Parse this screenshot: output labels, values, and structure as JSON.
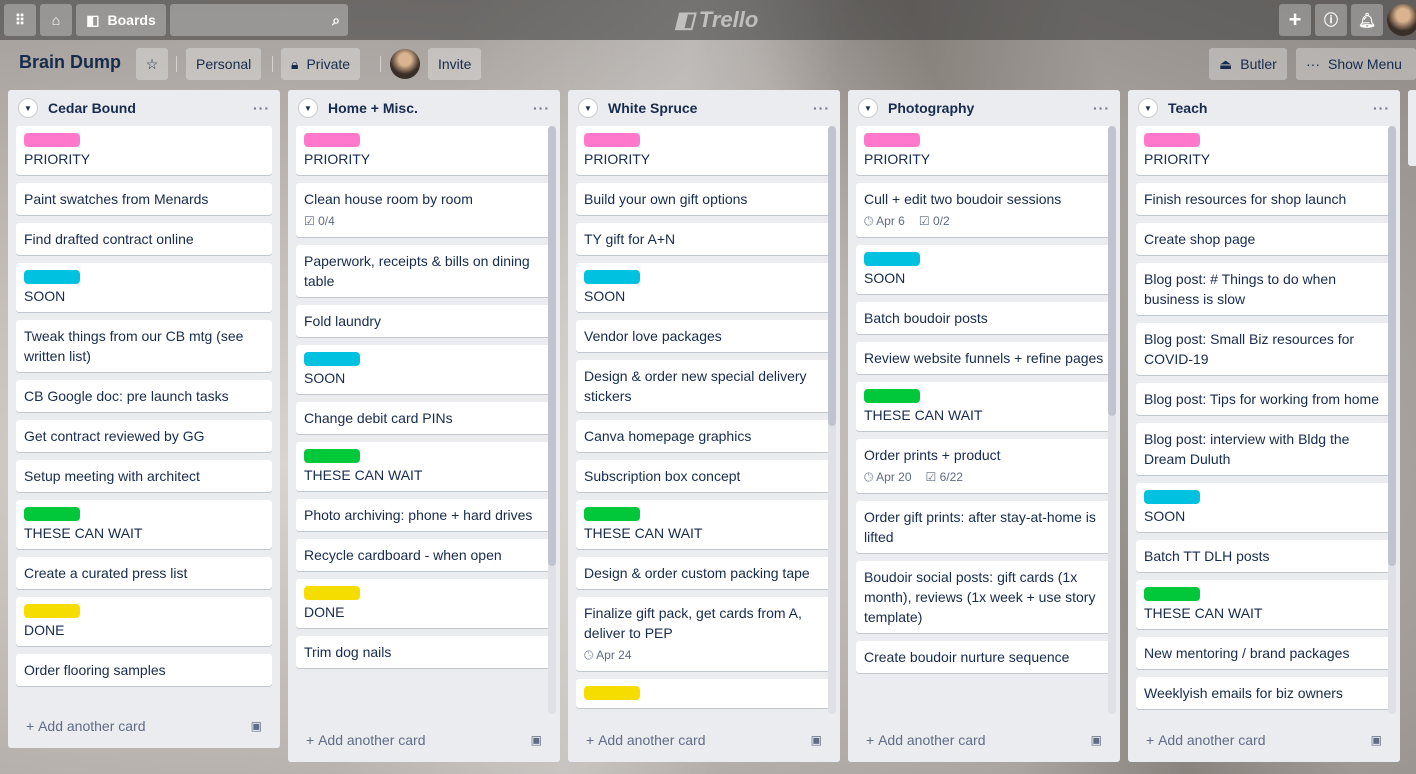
{
  "header": {
    "boards_label": "Boards",
    "logo_text": "Trello",
    "search_placeholder": ""
  },
  "board": {
    "title": "Brain Dump",
    "team": "Personal",
    "visibility": "Private",
    "invite": "Invite",
    "butler": "Butler",
    "show_menu": "Show Menu"
  },
  "colors": {
    "pink": "#ff78cb",
    "sky": "#00c2e0",
    "green": "#00c83b",
    "yellow": "#f5dd00"
  },
  "add_card_label": "Add another card",
  "lists": [
    {
      "title": "Cedar Bound",
      "cards": [
        {
          "label": "pink",
          "text": "PRIORITY"
        },
        {
          "text": "Paint swatches from Menards"
        },
        {
          "text": "Find drafted contract online"
        },
        {
          "label": "sky",
          "text": "SOON"
        },
        {
          "text": "Tweak things from our CB mtg (see written list)"
        },
        {
          "text": "CB Google doc: pre launch tasks"
        },
        {
          "text": "Get contract reviewed by GG"
        },
        {
          "text": "Setup meeting with architect"
        },
        {
          "label": "green",
          "text": "THESE CAN WAIT"
        },
        {
          "text": "Create a curated press list"
        },
        {
          "label": "yellow",
          "text": "DONE"
        },
        {
          "text": "Order flooring samples"
        }
      ]
    },
    {
      "title": "Home + Misc.",
      "cards": [
        {
          "label": "pink",
          "text": "PRIORITY"
        },
        {
          "text": "Clean house room by room",
          "checklist": "0/4"
        },
        {
          "text": "Paperwork, receipts & bills on dining table"
        },
        {
          "text": "Fold laundry"
        },
        {
          "label": "sky",
          "text": "SOON"
        },
        {
          "text": "Change debit card PINs"
        },
        {
          "label": "green",
          "text": "THESE CAN WAIT"
        },
        {
          "text": "Photo archiving: phone + hard drives"
        },
        {
          "text": "Recycle cardboard - when open"
        },
        {
          "label": "yellow",
          "text": "DONE"
        },
        {
          "text": "Trim dog nails"
        }
      ]
    },
    {
      "title": "White Spruce",
      "cards": [
        {
          "label": "pink",
          "text": "PRIORITY"
        },
        {
          "text": "Build your own gift options"
        },
        {
          "text": "TY gift for A+N"
        },
        {
          "label": "sky",
          "text": "SOON"
        },
        {
          "text": "Vendor love packages"
        },
        {
          "text": "Design & order new special delivery stickers"
        },
        {
          "text": "Canva homepage graphics"
        },
        {
          "text": "Subscription box concept"
        },
        {
          "label": "green",
          "text": "THESE CAN WAIT"
        },
        {
          "text": "Design & order custom packing tape"
        },
        {
          "text": "Finalize gift pack, get cards from A, deliver to PEP",
          "due": "Apr 24"
        },
        {
          "label": "yellow",
          "text": ""
        }
      ]
    },
    {
      "title": "Photography",
      "cards": [
        {
          "label": "pink",
          "text": "PRIORITY"
        },
        {
          "text": "Cull + edit two boudoir sessions",
          "due": "Apr 6",
          "checklist": "0/2"
        },
        {
          "label": "sky",
          "text": "SOON"
        },
        {
          "text": "Batch boudoir posts"
        },
        {
          "text": "Review website funnels + refine pages"
        },
        {
          "label": "green",
          "text": "THESE CAN WAIT"
        },
        {
          "text": "Order prints + product",
          "due": "Apr 20",
          "checklist": "6/22"
        },
        {
          "text": "Order gift prints: after stay-at-home is lifted"
        },
        {
          "text": "Boudoir social posts: gift cards (1x month), reviews (1x week + use story template)"
        },
        {
          "text": "Create boudoir nurture sequence"
        }
      ]
    },
    {
      "title": "Teach",
      "cards": [
        {
          "label": "pink",
          "text": "PRIORITY"
        },
        {
          "text": "Finish resources for shop launch"
        },
        {
          "text": "Create shop page"
        },
        {
          "text": "Blog post: # Things to do when business is slow"
        },
        {
          "text": "Blog post: Small Biz resources for COVID-19"
        },
        {
          "text": "Blog post: Tips for working from home"
        },
        {
          "text": "Blog post: interview with Bldg the Dream Duluth"
        },
        {
          "label": "sky",
          "text": "SOON"
        },
        {
          "text": "Batch TT DLH posts"
        },
        {
          "label": "green",
          "text": "THESE CAN WAIT"
        },
        {
          "text": "New mentoring / brand packages"
        },
        {
          "text": "Weeklyish emails for biz owners"
        }
      ]
    }
  ]
}
